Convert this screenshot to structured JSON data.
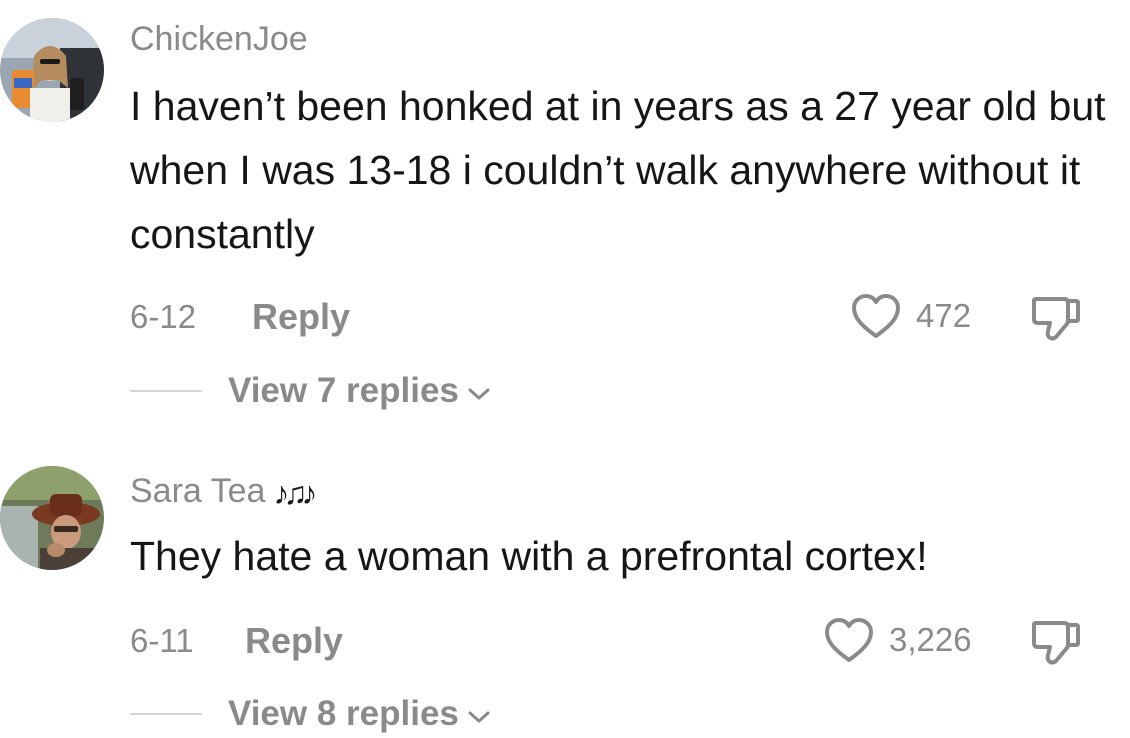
{
  "comments": [
    {
      "username": "ChickenJoe",
      "text": "I haven’t been honked at in years as a 27 year old but when I was 13-18 i couldn’t walk anywhere without it constantly",
      "date": "6-12",
      "reply_label": "Reply",
      "likes": "472",
      "view_replies": "View 7 replies",
      "avatar_icon": "profile-photo"
    },
    {
      "username": "Sara Tea",
      "username_suffix": "♪♫♪",
      "text": "They hate a woman with a prefrontal cortex!",
      "date": "6-11",
      "reply_label": "Reply",
      "likes": "3,226",
      "view_replies": "View 8 replies",
      "avatar_icon": "profile-photo"
    }
  ],
  "icons": {
    "like": "heart-outline-icon",
    "dislike": "thumbs-down-icon",
    "expand": "chevron-down-icon"
  },
  "colors": {
    "text": "#161616",
    "muted": "#8a8a8a",
    "divider": "#d6d6d6"
  }
}
